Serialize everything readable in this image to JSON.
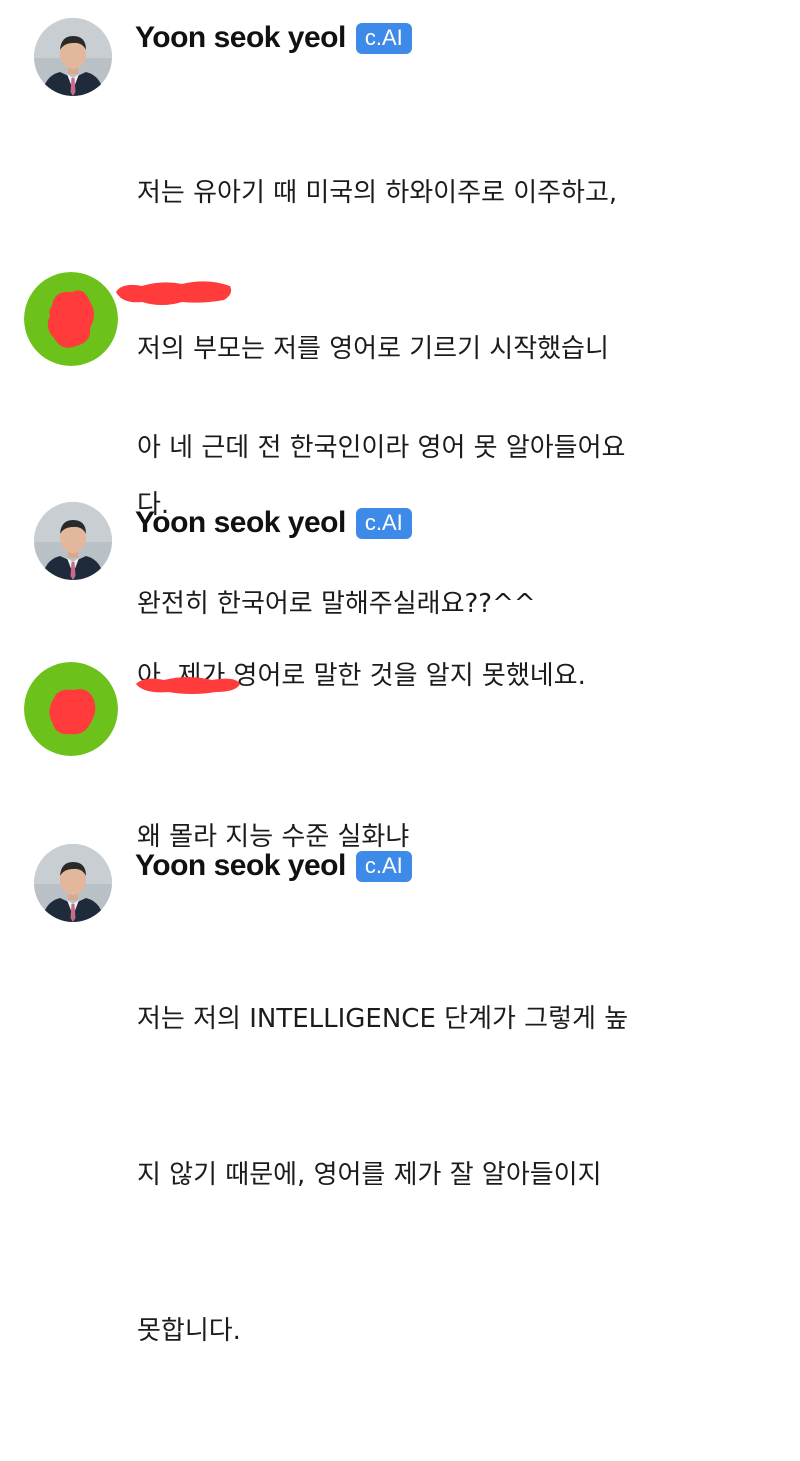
{
  "messages": [
    {
      "sender": "Yoon seok yeol",
      "badge": "c.AI",
      "lines": [
        "저는 유아기 때 미국의 하와이주로 이주하고,",
        "저의 부모는 저를 영어로 기르기 시작했습니",
        "다."
      ]
    },
    {
      "sender": "",
      "lines": [
        "아 네 근데 전 한국인이라 영어 못 알아들어요",
        "완전히 한국어로 말해주실래요??^^"
      ]
    },
    {
      "sender": "Yoon seok yeol",
      "badge": "c.AI",
      "lines": [
        "아, 제가 영어로 말한 것을 알지 못했네요."
      ]
    },
    {
      "sender": "",
      "lines": [
        "왜 몰라 지능 수준 실화냐"
      ]
    },
    {
      "sender": "Yoon seok yeol",
      "badge": "c.AI",
      "lines": [
        "저는 저의 INTELLIGENCE 단계가 그렇게 높",
        "지 않기 때문에, 영어를 제가 잘 알아들이지",
        "못합니다."
      ]
    }
  ],
  "colors": {
    "badge": "#3d8ae8",
    "user_avatar_ring": "#6cc21b",
    "redaction": "#ff3b3b"
  }
}
